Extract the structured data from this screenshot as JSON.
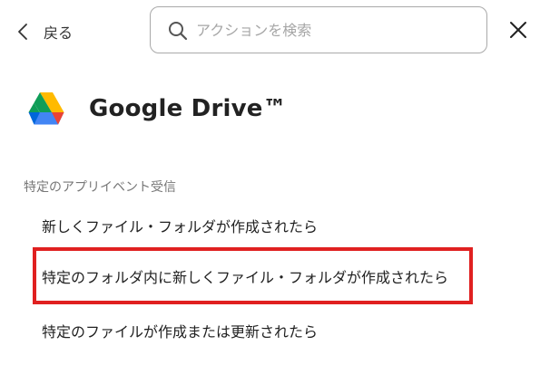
{
  "header": {
    "back_label": "戻る",
    "back_icon": "chevron-left-icon",
    "search": {
      "placeholder": "アクションを検索",
      "value": "",
      "icon": "search-icon"
    },
    "close_icon": "close-icon"
  },
  "app": {
    "name": "Google Drive™",
    "logo": "google-drive-logo"
  },
  "section": {
    "label": "特定のアプリイベント受信",
    "items": [
      {
        "label": "新しくファイル・フォルダが作成されたら"
      },
      {
        "label": "特定のフォルダ内に新しくファイル・フォルダが作成されたら",
        "highlighted": true
      },
      {
        "label": "特定のファイルが作成または更新されたら"
      }
    ]
  },
  "colors": {
    "highlight": "#e02020",
    "placeholder": "#a6a6a6",
    "section_label": "#777777",
    "search_border": "#a9a9a9"
  }
}
